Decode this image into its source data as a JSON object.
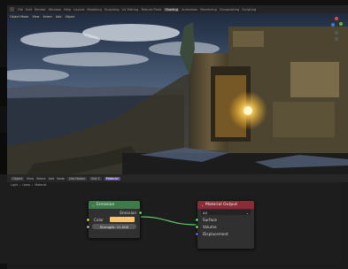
{
  "topbar": {
    "items": [
      "File",
      "Edit",
      "Render",
      "Window",
      "Help",
      "Layout",
      "Modeling",
      "Sculpting",
      "UV Editing",
      "Texture Paint",
      "Shading",
      "Animation",
      "Rendering",
      "Compositing",
      "Scripting"
    ],
    "active_index": 11
  },
  "viewport": {
    "header_items": [
      "Object Mode",
      "View",
      "Select",
      "Add",
      "Object"
    ],
    "sky_top": "#1f2b40",
    "sky_mid": "#566a86",
    "cloud": "#d6dde6",
    "rock": "#6a5b3e",
    "light_color": "#ffd35a"
  },
  "node_toolbar": {
    "items": [
      "Object",
      "View",
      "Select",
      "Add",
      "Node",
      "Use Nodes",
      "Slot 1",
      "Material"
    ],
    "selected": "Material"
  },
  "breadcrumb": [
    "Light",
    "Lamp",
    "Material"
  ],
  "nodes": {
    "emission": {
      "title": "Emission",
      "output_label": "Emission",
      "color_label": "Color",
      "color_value": "#f4c46a",
      "strength_label": "Strength: 11.000"
    },
    "output": {
      "title": "Material Output",
      "target": "All",
      "inputs": [
        "Surface",
        "Volume",
        "Displacement"
      ]
    }
  },
  "colors": {
    "emission_header": "#3f7a4a",
    "output_header": "#8a2c35",
    "shader_socket": "#63c763",
    "color_socket": "#c7c729",
    "value_socket": "#a1a1a1",
    "vector_socket": "#6363c7"
  }
}
